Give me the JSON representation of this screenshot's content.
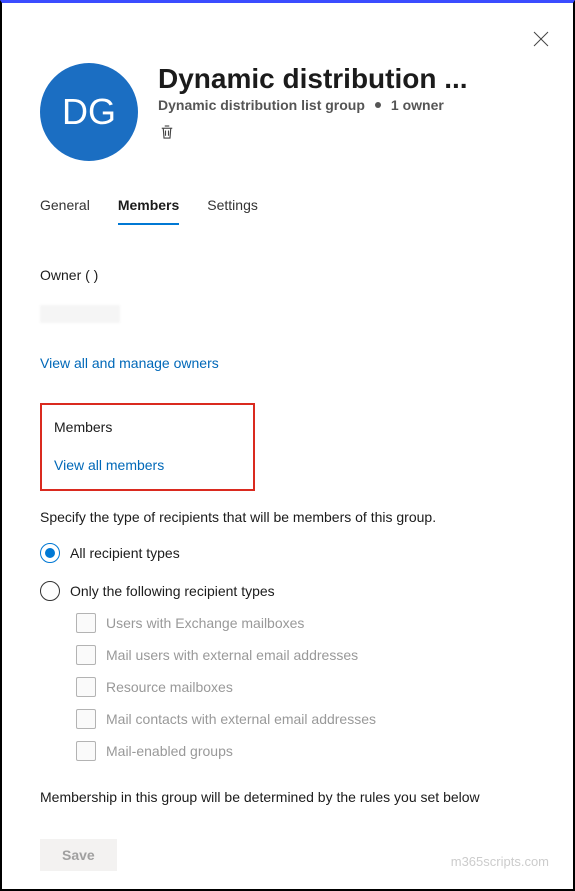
{
  "header": {
    "initials": "DG",
    "title": "Dynamic distribution ...",
    "subtitle_type": "Dynamic distribution list group",
    "owner_count": "1 owner"
  },
  "tabs": {
    "general": "General",
    "members": "Members",
    "settings": "Settings"
  },
  "owner": {
    "label": "Owner (  )",
    "manage_link": "View all and manage owners"
  },
  "members_box": {
    "title": "Members",
    "link": "View all members"
  },
  "recipients": {
    "description": "Specify the type of recipients that will be members of this group.",
    "option_all": "All recipient types",
    "option_following": "Only the following recipient types",
    "types": [
      "Users with Exchange mailboxes",
      "Mail users with external email addresses",
      "Resource mailboxes",
      "Mail contacts with external email addresses",
      "Mail-enabled groups"
    ]
  },
  "rules_text": "Membership in this group will be determined by the rules you set below",
  "save_label": "Save",
  "watermark": "m365scripts.com"
}
